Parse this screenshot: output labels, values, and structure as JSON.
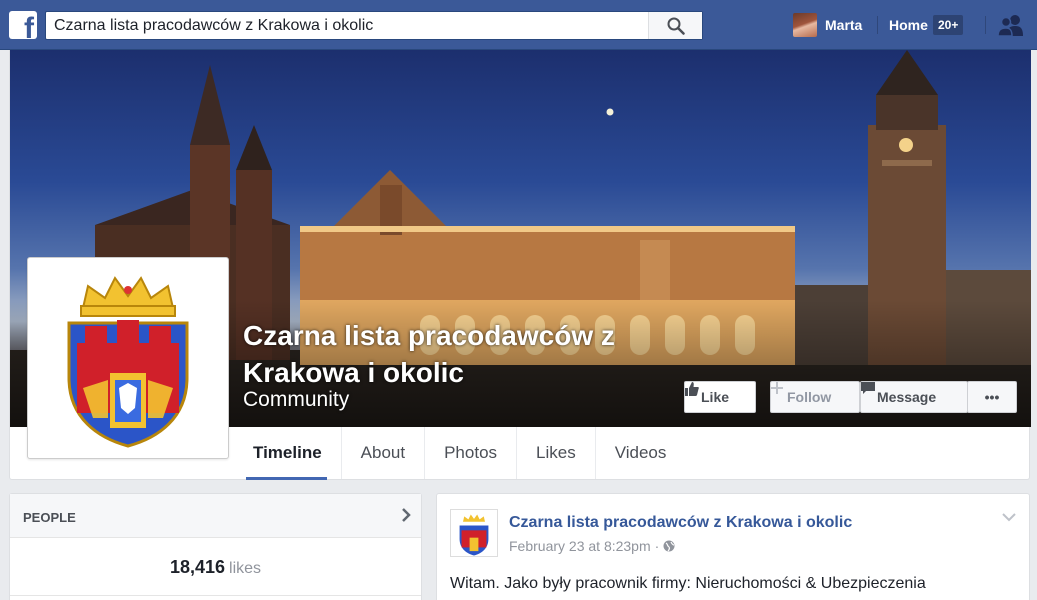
{
  "topbar": {
    "logo": "facebook-logo",
    "search_value": "Czarna lista pracodawców z Krakowa i okolic",
    "user_name": "Marta",
    "home_label": "Home",
    "notification_count": "20+"
  },
  "page": {
    "title": "Czarna lista pracodawców z Krakowa i okolic",
    "category": "Community"
  },
  "actions": {
    "like": "Like",
    "follow": "Follow",
    "message": "Message",
    "more": "•••"
  },
  "tabs": [
    "Timeline",
    "About",
    "Photos",
    "Likes",
    "Videos"
  ],
  "people": {
    "title": "PEOPLE",
    "likes_count": "18,416",
    "likes_label": "likes"
  },
  "post": {
    "author": "Czarna lista pracodawców z Krakowa i okolic",
    "date": "February 23 at 8:23pm",
    "audience_icon": "globe-icon",
    "text": "Witam. Jako były pracownik firmy: Nieruchomości & Ubezpieczenia"
  },
  "colors": {
    "brand_blue": "#3b5998",
    "link_blue": "#365899",
    "tab_underline": "#4267b2"
  }
}
